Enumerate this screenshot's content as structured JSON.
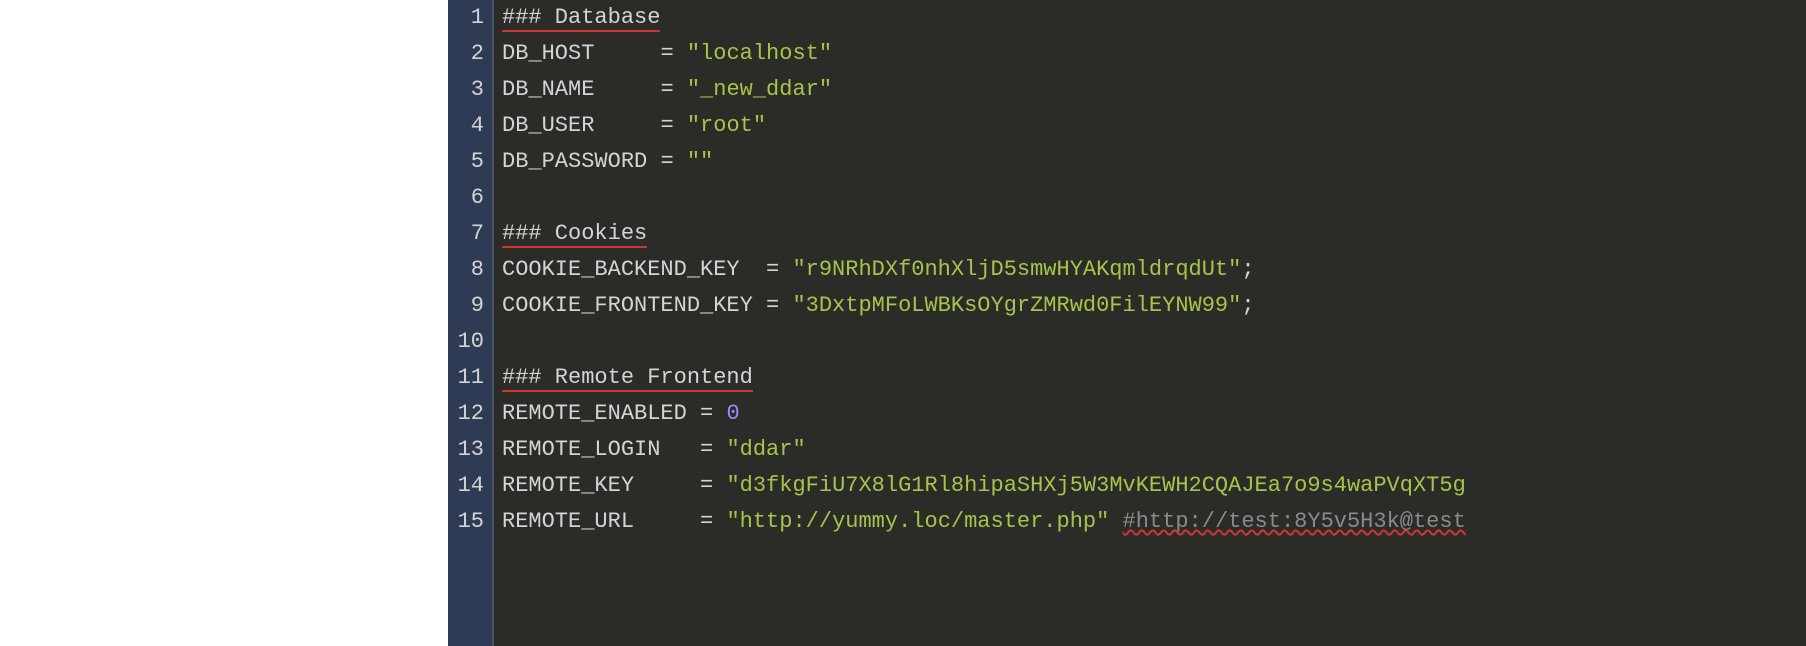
{
  "editor": {
    "lines": [
      {
        "num": 1,
        "segments": [
          {
            "t": "### Database",
            "cls": "tok-var underline-red"
          }
        ]
      },
      {
        "num": 2,
        "segments": [
          {
            "t": "DB_HOST     ",
            "cls": "tok-var"
          },
          {
            "t": "=",
            "cls": "tok-op"
          },
          {
            "t": " ",
            "cls": ""
          },
          {
            "t": "\"localhost\"",
            "cls": "tok-str"
          }
        ]
      },
      {
        "num": 3,
        "segments": [
          {
            "t": "DB_NAME     ",
            "cls": "tok-var"
          },
          {
            "t": "=",
            "cls": "tok-op"
          },
          {
            "t": " ",
            "cls": ""
          },
          {
            "t": "\"_new_ddar\"",
            "cls": "tok-str"
          }
        ]
      },
      {
        "num": 4,
        "segments": [
          {
            "t": "DB_USER     ",
            "cls": "tok-var"
          },
          {
            "t": "=",
            "cls": "tok-op"
          },
          {
            "t": " ",
            "cls": ""
          },
          {
            "t": "\"root\"",
            "cls": "tok-str"
          }
        ]
      },
      {
        "num": 5,
        "segments": [
          {
            "t": "DB_PASSWORD ",
            "cls": "tok-var"
          },
          {
            "t": "=",
            "cls": "tok-op"
          },
          {
            "t": " ",
            "cls": ""
          },
          {
            "t": "\"\"",
            "cls": "tok-str"
          }
        ]
      },
      {
        "num": 6,
        "segments": []
      },
      {
        "num": 7,
        "segments": [
          {
            "t": "### Cookies",
            "cls": "tok-var underline-red"
          }
        ]
      },
      {
        "num": 8,
        "segments": [
          {
            "t": "COOKIE_BACKEND_KEY  ",
            "cls": "tok-var"
          },
          {
            "t": "=",
            "cls": "tok-op"
          },
          {
            "t": " ",
            "cls": ""
          },
          {
            "t": "\"r9NRhDXf0nhXljD5smwHYAKqmldrqdUt\"",
            "cls": "tok-str"
          },
          {
            "t": ";",
            "cls": "tok-punct"
          }
        ]
      },
      {
        "num": 9,
        "segments": [
          {
            "t": "COOKIE_FRONTEND_KEY ",
            "cls": "tok-var"
          },
          {
            "t": "=",
            "cls": "tok-op"
          },
          {
            "t": " ",
            "cls": ""
          },
          {
            "t": "\"3DxtpMFoLWBKsOYgrZMRwd0FilEYNW99\"",
            "cls": "tok-str"
          },
          {
            "t": ";",
            "cls": "tok-punct"
          }
        ]
      },
      {
        "num": 10,
        "segments": []
      },
      {
        "num": 11,
        "segments": [
          {
            "t": "### Remote Frontend",
            "cls": "tok-var underline-red"
          }
        ]
      },
      {
        "num": 12,
        "segments": [
          {
            "t": "REMOTE_ENABLED ",
            "cls": "tok-var"
          },
          {
            "t": "=",
            "cls": "tok-op"
          },
          {
            "t": " ",
            "cls": ""
          },
          {
            "t": "0",
            "cls": "tok-num"
          }
        ]
      },
      {
        "num": 13,
        "segments": [
          {
            "t": "REMOTE_LOGIN   ",
            "cls": "tok-var"
          },
          {
            "t": "=",
            "cls": "tok-op"
          },
          {
            "t": " ",
            "cls": ""
          },
          {
            "t": "\"ddar\"",
            "cls": "tok-str"
          }
        ]
      },
      {
        "num": 14,
        "segments": [
          {
            "t": "REMOTE_KEY     ",
            "cls": "tok-var"
          },
          {
            "t": "=",
            "cls": "tok-op"
          },
          {
            "t": " ",
            "cls": ""
          },
          {
            "t": "\"d3fkgFiU7X8lG1Rl8hipaSHXj5W3MvKEWH2CQAJEa7o9s4waPVqXT5g",
            "cls": "tok-str"
          }
        ]
      },
      {
        "num": 15,
        "segments": [
          {
            "t": "REMOTE_URL     ",
            "cls": "tok-var"
          },
          {
            "t": "=",
            "cls": "tok-op"
          },
          {
            "t": " ",
            "cls": ""
          },
          {
            "t": "\"http://yummy.loc/master.php\"",
            "cls": "tok-str"
          },
          {
            "t": " ",
            "cls": ""
          },
          {
            "t": "#http://test:8Y5v5H3k@test",
            "cls": "tok-comment spell-wavy"
          }
        ]
      }
    ]
  }
}
